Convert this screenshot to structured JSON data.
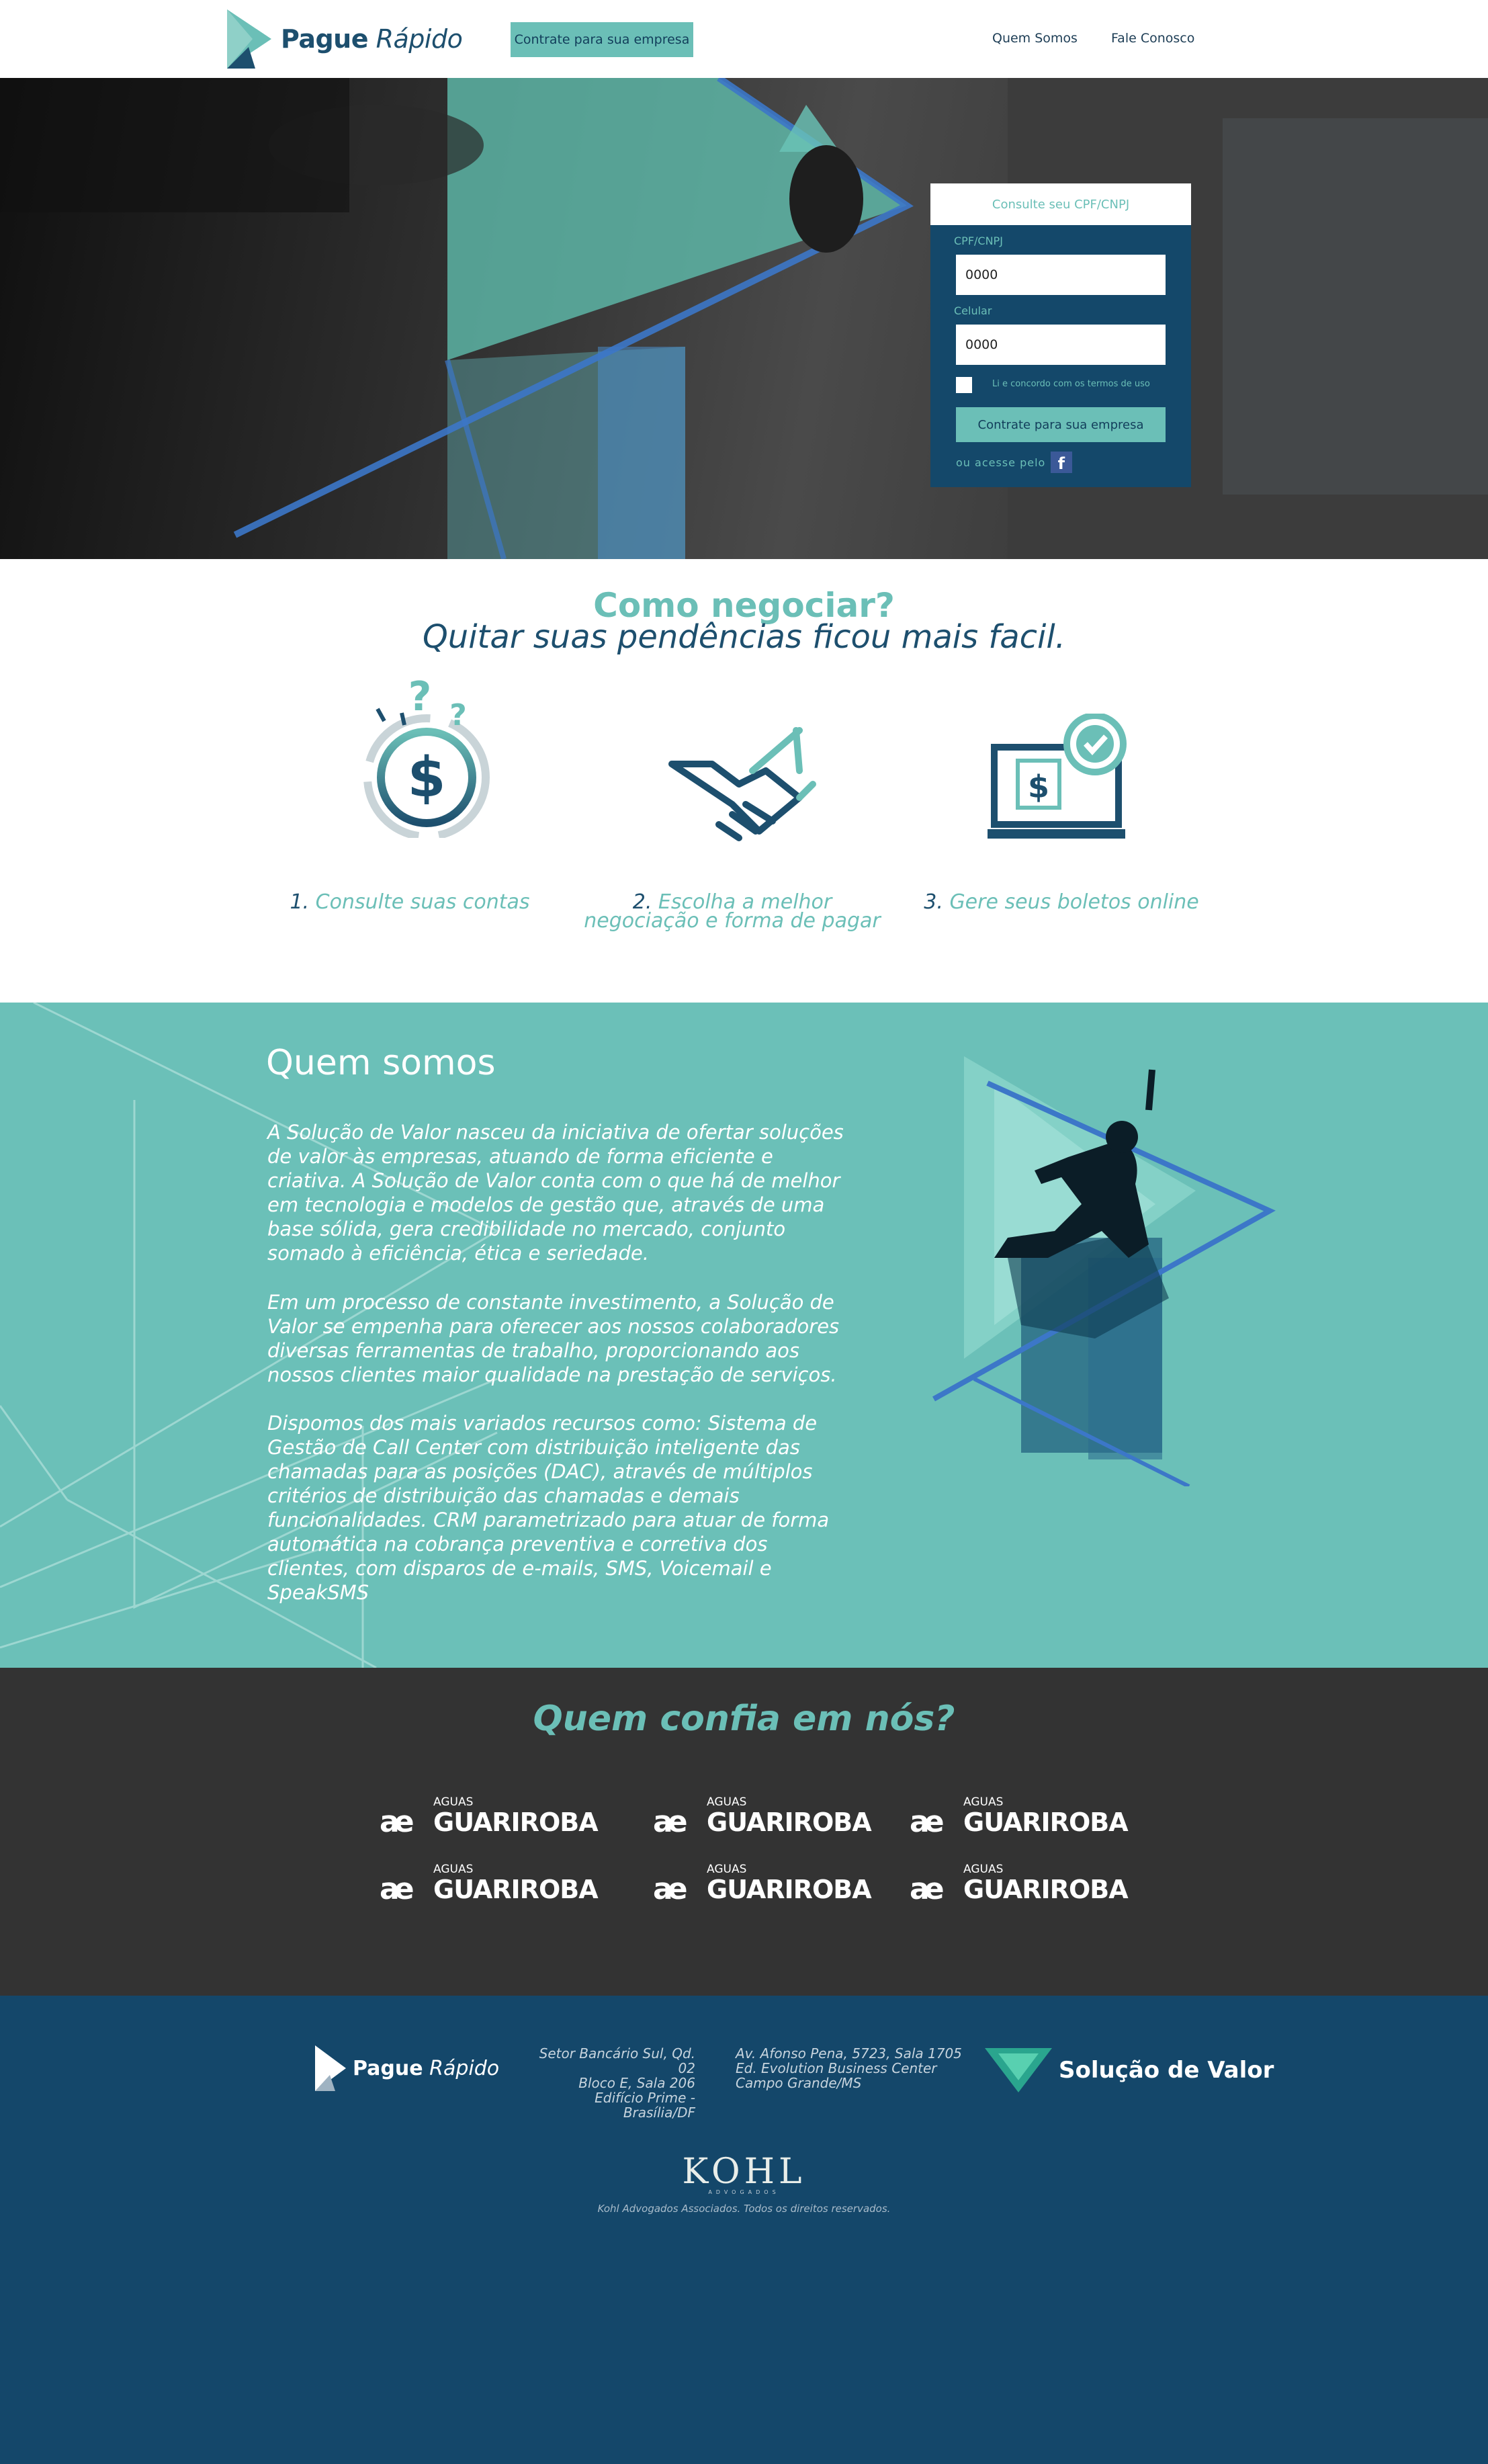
{
  "header": {
    "logo_bold": "Pague",
    "logo_italic": "Rápido",
    "cta_label": "Contrate para sua empresa",
    "nav": [
      "Quem Somos",
      "Fale Conosco"
    ]
  },
  "hero_form": {
    "title": "Consulte seu CPF/CNPJ",
    "cpf_label": "CPF/CNPJ",
    "cpf_value": "0000",
    "phone_label": "Celular",
    "phone_value": "0000",
    "terms_label": "Li e concordo com os termos de uso",
    "submit_label": "Contrate para sua empresa",
    "alt_label": "ou acesse pelo",
    "facebook_icon": "facebook-icon"
  },
  "how": {
    "title": "Como negociar?",
    "subtitle": "Quitar suas pendências ficou mais facil.",
    "steps": [
      {
        "num": "1.",
        "text": "Consulte suas contas",
        "icon": "money-question-icon"
      },
      {
        "num": "2.",
        "text_line1": "Escolha a melhor",
        "text_line2": "negociação e forma de pagar",
        "icon": "handshake-icon"
      },
      {
        "num": "3.",
        "text": "Gere seus boletos online",
        "icon": "laptop-bill-check-icon"
      }
    ]
  },
  "about": {
    "title": "Quem somos",
    "p1": "A Solução de Valor nasceu da iniciativa de ofertar soluções de valor às empresas, atuando de forma eficiente e criativa. A Solução de Valor conta com o que há de melhor em tecnologia e modelos de gestão que, através de uma base sólida, gera credibilidade no mercado, conjunto somado à eficiência, ética e seriedade.",
    "p2": "Em um processo de constante investimento, a Solução de Valor se empenha para oferecer aos nossos colaboradores diversas ferramentas de trabalho, proporcionando aos nossos clientes maior qualidade na prestação de serviços.",
    "p3": "Dispomos dos mais variados recursos como: Sistema de Gestão de Call Center com distribuição inteligente das chamadas para as posições (DAC), através de múltiplos critérios de distribuição das chamadas e demais funcionalidades. CRM parametrizado para atuar de forma automática na cobrança preventiva e corretiva dos clientes, com disparos de e-mails, SMS, Voicemail e SpeakSMS"
  },
  "clients": {
    "title": "Quem confia em nós?",
    "logos": [
      {
        "small": "AGUAS",
        "big": "GUARIROBA",
        "mark": "ae"
      },
      {
        "small": "AGUAS",
        "big": "GUARIROBA",
        "mark": "ae"
      },
      {
        "small": "AGUAS",
        "big": "GUARIROBA",
        "mark": "ae"
      },
      {
        "small": "AGUAS",
        "big": "GUARIROBA",
        "mark": "ae"
      },
      {
        "small": "AGUAS",
        "big": "GUARIROBA",
        "mark": "ae"
      },
      {
        "small": "AGUAS",
        "big": "GUARIROBA",
        "mark": "ae"
      }
    ]
  },
  "footer": {
    "logo_bold": "Pague",
    "logo_italic": "Rápido",
    "addr1": [
      "Setor Bancário Sul, Qd. 02",
      "Bloco E, Sala 206",
      "Edifício Prime - Brasília/DF"
    ],
    "addr2": [
      "Av. Afonso Pena, 5723, Sala 1705",
      "Ed. Evolution Business Center",
      "Campo Grande/MS"
    ],
    "partner": "Solução de Valor",
    "kohl": "KOHL",
    "kohl_sub": "ADVOGADOS",
    "copyright": "Kohl Advogados Associados. Todos os direitos reservados."
  },
  "colors": {
    "teal": "#6bbfb7",
    "navy": "#14476a",
    "dark": "#333333"
  }
}
